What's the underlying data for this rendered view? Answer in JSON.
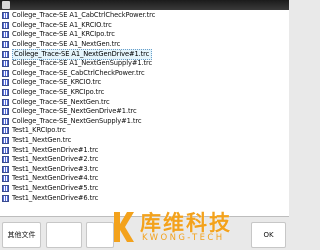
{
  "window": {
    "title": ""
  },
  "files": [
    {
      "label": "College_Trace-SE A1_CabCtrlCheckPower.trc",
      "selected": false
    },
    {
      "label": "College_Trace-SE A1_KRCIO.trc",
      "selected": false
    },
    {
      "label": "College_Trace-SE A1_KRCIpo.trc",
      "selected": false
    },
    {
      "label": "College_Trace-SE A1_NextGen.trc",
      "selected": false
    },
    {
      "label": "College_Trace-SE A1_NextGenDrive#1.trc",
      "selected": true
    },
    {
      "label": "College_Trace-SE A1_NextGenSupply#1.trc",
      "selected": false
    },
    {
      "label": "College_Trace-SE_CabCtrlCheckPower.trc",
      "selected": false
    },
    {
      "label": "College_Trace-SE_KRCIO.trc",
      "selected": false
    },
    {
      "label": "College_Trace-SE_KRCIpo.trc",
      "selected": false
    },
    {
      "label": "College_Trace-SE_NextGen.trc",
      "selected": false
    },
    {
      "label": "College_Trace-SE_NextGenDrive#1.trc",
      "selected": false
    },
    {
      "label": "College_Trace-SE_NextGenSupply#1.trc",
      "selected": false
    },
    {
      "label": "Test1_KRCIpo.trc",
      "selected": false
    },
    {
      "label": "Test1_NextGen.trc",
      "selected": false
    },
    {
      "label": "Test1_NextGenDrive#1.trc",
      "selected": false
    },
    {
      "label": "Test1_NextGenDrive#2.trc",
      "selected": false
    },
    {
      "label": "Test1_NextGenDrive#3.trc",
      "selected": false
    },
    {
      "label": "Test1_NextGenDrive#4.trc",
      "selected": false
    },
    {
      "label": "Test1_NextGenDrive#5.trc",
      "selected": false
    },
    {
      "label": "Test1_NextGenDrive#6.trc",
      "selected": false
    }
  ],
  "buttons": {
    "other_files": "其他文件",
    "blank1": "",
    "blank2": "",
    "ok": "OK"
  },
  "watermark": {
    "cn": "库维科技",
    "en": "KWONG-TECH"
  },
  "colors": {
    "selection": "#e4f4fb",
    "file_icon": "#556bd8",
    "watermark": "#f3a21c"
  }
}
